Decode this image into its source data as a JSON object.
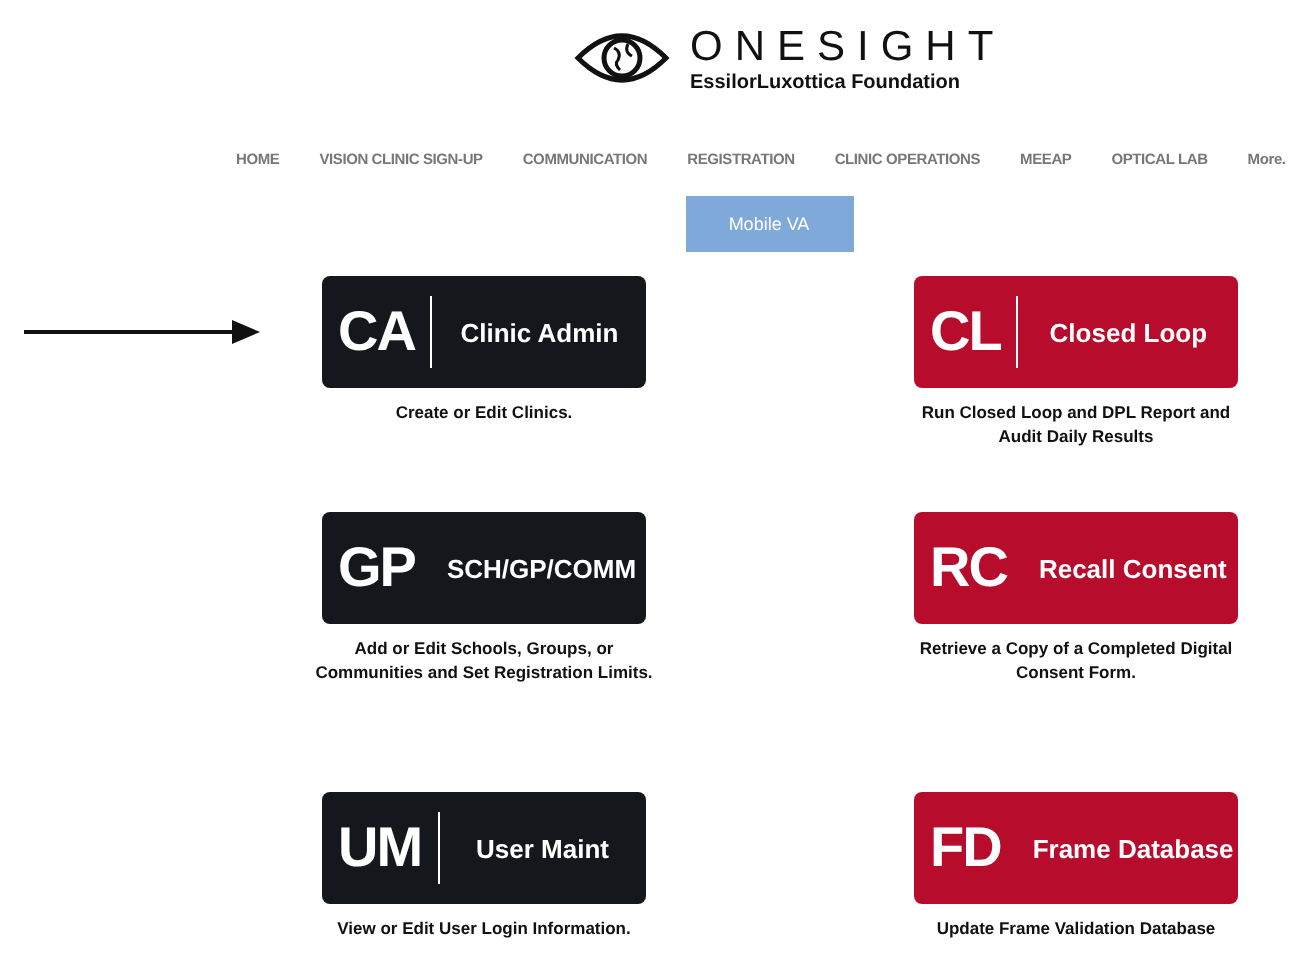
{
  "logo": {
    "name": "ONESIGHT",
    "subtitle": "EssilorLuxottica Foundation"
  },
  "nav": [
    {
      "label": "HOME"
    },
    {
      "label": "VISION CLINIC SIGN-UP"
    },
    {
      "label": "COMMUNICATION"
    },
    {
      "label": "REGISTRATION"
    },
    {
      "label": "CLINIC OPERATIONS"
    },
    {
      "label": "MEEAP"
    },
    {
      "label": "OPTICAL LAB"
    },
    {
      "label": "More."
    }
  ],
  "sub_nav": {
    "label": "Mobile VA"
  },
  "tiles": [
    {
      "abbr": "CA",
      "label": "Clinic Admin",
      "color": "#14181d",
      "description": "Create or Edit Clinics.",
      "pointed": true
    },
    {
      "abbr": "CL",
      "label": "Closed Loop",
      "color": "#b80c2c",
      "description": "Run Closed Loop and DPL Report and Audit Daily Results",
      "pointed": false
    },
    {
      "abbr": "GP",
      "label": "SCH/GP/COMM",
      "color": "#14181d",
      "description": "Add or Edit Schools, Groups, or Communities and Set Registration Limits.",
      "pointed": false
    },
    {
      "abbr": "RC",
      "label": "Recall Consent",
      "color": "#b80c2c",
      "description": "Retrieve a Copy of a Completed Digital Consent Form.",
      "pointed": false
    },
    {
      "abbr": "UM",
      "label": "User Maint",
      "color": "#14181d",
      "description": "View or Edit User Login Information.",
      "pointed": false
    },
    {
      "abbr": "FD",
      "label": "Frame Database",
      "color": "#b80c2c",
      "description": "Update Frame Validation Database",
      "pointed": false
    }
  ]
}
